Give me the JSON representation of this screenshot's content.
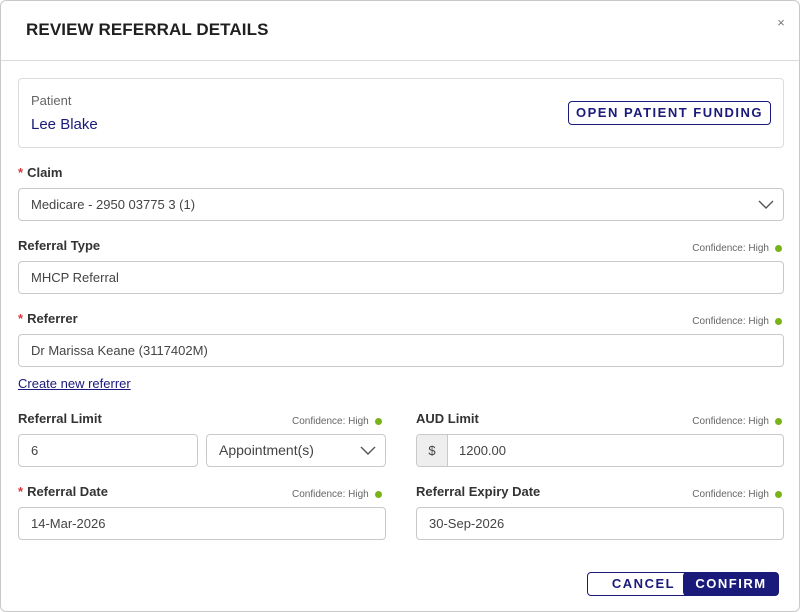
{
  "modal": {
    "title": "REVIEW REFERRAL DETAILS",
    "close_glyph": "×"
  },
  "patient": {
    "label": "Patient",
    "name": "Lee Blake",
    "open_funding_label": "OPEN PATIENT FUNDING"
  },
  "claim": {
    "required_marker": "*",
    "label": "Claim",
    "value": "Medicare - 2950 03775 3 (1)"
  },
  "referral_type": {
    "label": "Referral Type",
    "confidence": "Confidence: High",
    "value": "MHCP Referral"
  },
  "referrer": {
    "required_marker": "*",
    "label": "Referrer",
    "confidence": "Confidence: High",
    "value": "Dr Marissa Keane (3117402M)",
    "create_link": "Create new referrer"
  },
  "referral_limit": {
    "label": "Referral Limit",
    "confidence": "Confidence: High",
    "value": "6",
    "unit": "Appointment(s)"
  },
  "aud_limit": {
    "label": "AUD Limit",
    "confidence": "Confidence: High",
    "prefix": "$",
    "value": "1200.00"
  },
  "referral_date": {
    "required_marker": "*",
    "label": "Referral Date",
    "confidence": "Confidence: High",
    "value": "14-Mar-2026"
  },
  "referral_expiry": {
    "label": "Referral Expiry Date",
    "confidence": "Confidence: High",
    "value": "30-Sep-2026"
  },
  "actions": {
    "cancel_label": "CANCEL",
    "confirm_label": "CONFIRM"
  },
  "colors": {
    "brand": "#1a1a7a",
    "required": "#d9363e",
    "confidence_high": "#7ab317"
  }
}
